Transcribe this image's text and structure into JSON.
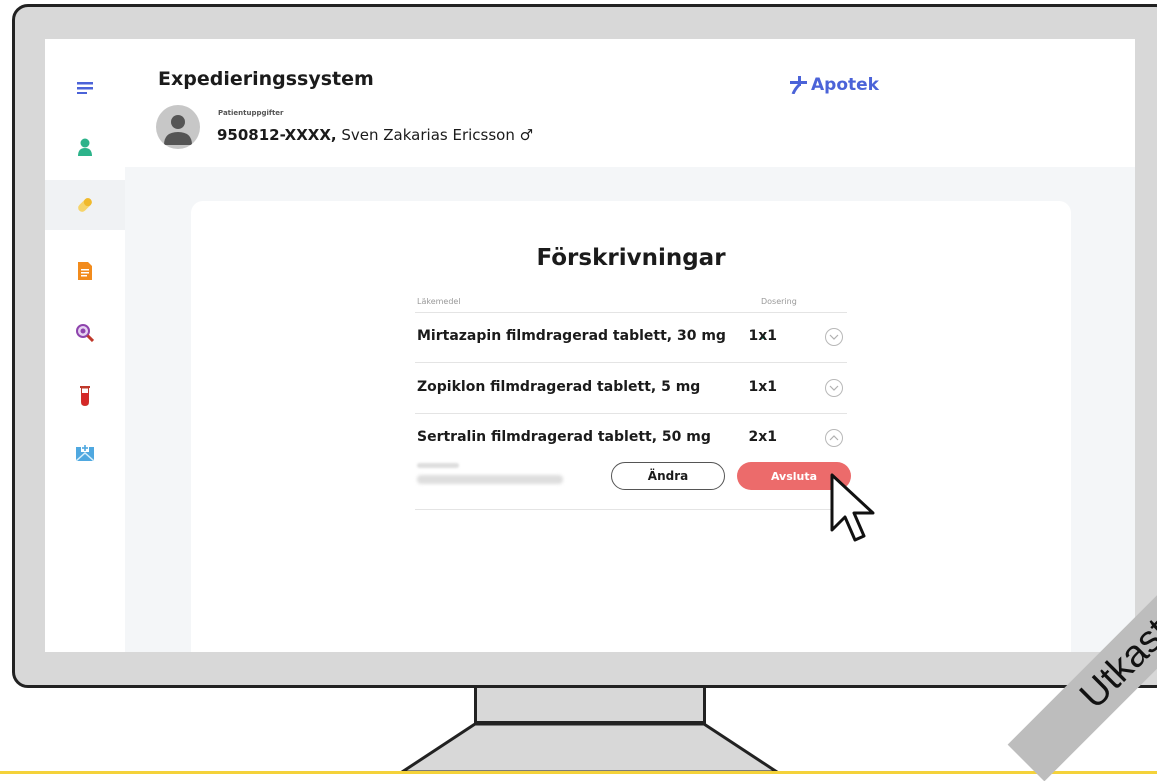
{
  "app": {
    "title": "Expedieringssystem",
    "brand_label": "Apotek",
    "brand_color": "#4b63d8"
  },
  "patient": {
    "label": "Patientuppgifter",
    "id": "950812-XXXX,",
    "name": "Sven Zakarias Ericsson",
    "gender_symbol": "♂"
  },
  "sidebar": {
    "items": [
      {
        "icon": "menu-icon",
        "active": false
      },
      {
        "icon": "patient-icon",
        "active": false
      },
      {
        "icon": "pill-icon",
        "active": true
      },
      {
        "icon": "document-icon",
        "active": false
      },
      {
        "icon": "search-icon",
        "active": false
      },
      {
        "icon": "test-tube-icon",
        "active": false
      },
      {
        "icon": "medical-mail-icon",
        "active": false
      }
    ]
  },
  "prescriptions": {
    "title": "Förskrivningar",
    "col_medicine": "Läkemedel",
    "col_dosage": "Dosering",
    "rows": [
      {
        "name": "Mirtazapin filmdragerad tablett, 30 mg",
        "dose": "1x1",
        "indicator": true,
        "expanded": false
      },
      {
        "name": "Zopiklon filmdragerad tablett, 5 mg",
        "dose": "1x1",
        "indicator": false,
        "expanded": false
      },
      {
        "name": "Sertralin filmdragerad tablett, 50 mg",
        "dose": "2x1",
        "indicator": false,
        "expanded": true
      }
    ],
    "edit_label": "Ändra",
    "end_label": "Avsluta",
    "end_color": "#ec6b6b"
  },
  "watermark": "Utkast"
}
